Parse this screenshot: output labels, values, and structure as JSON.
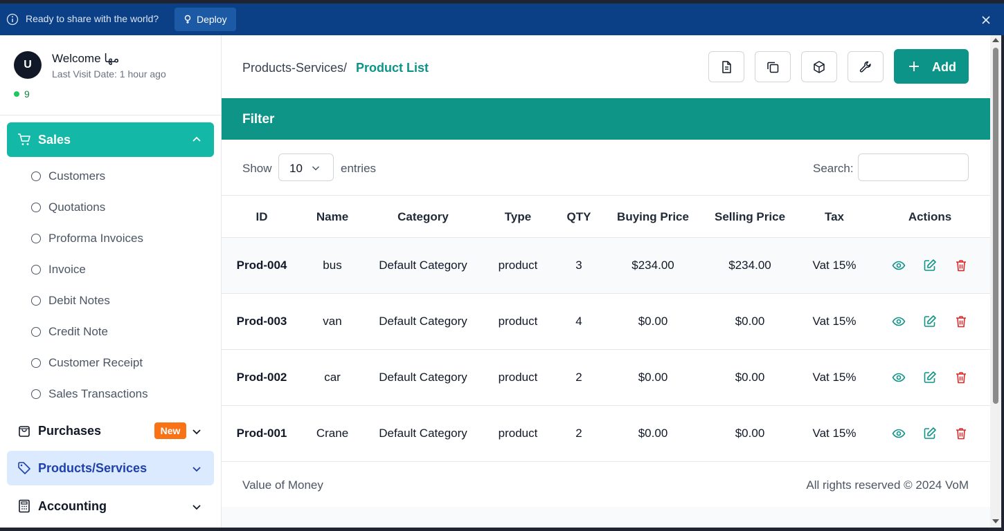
{
  "banner": {
    "message": "Ready to share with the world?",
    "deploy_label": "Deploy"
  },
  "user": {
    "avatar_letter": "U",
    "welcome": "Welcome مها",
    "last_visit": "Last Visit Date: 1 hour ago",
    "online_count": "9"
  },
  "sidebar": {
    "sales_label": "Sales",
    "sales_items": [
      {
        "label": "Customers"
      },
      {
        "label": "Quotations"
      },
      {
        "label": "Proforma Invoices"
      },
      {
        "label": "Invoice"
      },
      {
        "label": "Debit Notes"
      },
      {
        "label": "Credit Note"
      },
      {
        "label": "Customer Receipt"
      },
      {
        "label": "Sales Transactions"
      }
    ],
    "purchases_label": "Purchases",
    "purchases_badge": "New",
    "products_label": "Products/Services",
    "accounting_label": "Accounting"
  },
  "breadcrumb": {
    "parent": "Products-Services",
    "separator": "/",
    "current": "Product List"
  },
  "toolbar": {
    "add_label": "Add",
    "icons": [
      "document-icon",
      "copy-icon",
      "box-icon",
      "wrench-icon"
    ]
  },
  "filter": {
    "title": "Filter"
  },
  "controls": {
    "show_label": "Show",
    "entries_value": "10",
    "entries_label": "entries",
    "search_label": "Search:",
    "search_value": ""
  },
  "table": {
    "headers": {
      "id": "ID",
      "name": "Name",
      "category": "Category",
      "type": "Type",
      "qty": "QTY",
      "buying": "Buying Price",
      "selling": "Selling Price",
      "tax": "Tax",
      "actions": "Actions"
    },
    "rows": [
      {
        "id": "Prod-004",
        "name": "bus",
        "category": "Default Category",
        "type": "product",
        "qty": "3",
        "buying": "$234.00",
        "selling": "$234.00",
        "tax": "Vat 15%"
      },
      {
        "id": "Prod-003",
        "name": "van",
        "category": "Default Category",
        "type": "product",
        "qty": "4",
        "buying": "$0.00",
        "selling": "$0.00",
        "tax": "Vat 15%"
      },
      {
        "id": "Prod-002",
        "name": "car",
        "category": "Default Category",
        "type": "product",
        "qty": "2",
        "buying": "$0.00",
        "selling": "$0.00",
        "tax": "Vat 15%"
      },
      {
        "id": "Prod-001",
        "name": "Crane",
        "category": "Default Category",
        "type": "product",
        "qty": "2",
        "buying": "$0.00",
        "selling": "$0.00",
        "tax": "Vat 15%"
      }
    ]
  },
  "footer": {
    "left": "Value of Money",
    "right": "All rights reserved © 2024 VoM"
  },
  "colors": {
    "banner": "#0b3f86",
    "accent": "#0d9488",
    "sales_active": "#14b8a6",
    "products_active_bg": "#dbeafe",
    "badge": "#f97316",
    "delete": "#dc2626"
  }
}
